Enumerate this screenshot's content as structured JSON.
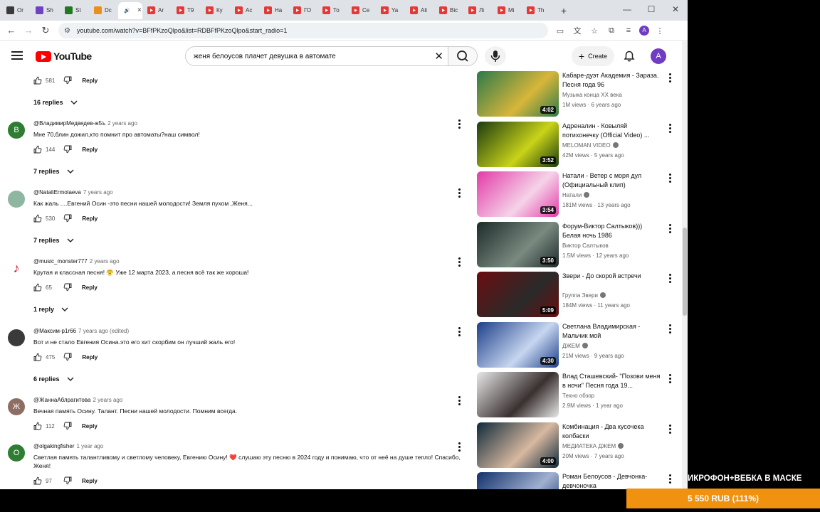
{
  "browser": {
    "tabs": [
      {
        "label": "Or",
        "icon": "tab-favicon",
        "color": "#3a3a3a"
      },
      {
        "label": "Sh",
        "icon": "tab-favicon",
        "color": "#6f42c1"
      },
      {
        "label": "St",
        "icon": "tab-favicon",
        "color": "#1f7a1f"
      },
      {
        "label": "Dc",
        "icon": "tab-favicon",
        "color": "#e8901b"
      },
      {
        "label": "",
        "icon": "speaker-icon",
        "color": "#777777",
        "active": true
      },
      {
        "label": "Ar",
        "icon": "youtube-favicon",
        "color": "#e53935"
      },
      {
        "label": "T9",
        "icon": "youtube-favicon",
        "color": "#e53935"
      },
      {
        "label": "Ку",
        "icon": "youtube-favicon",
        "color": "#e53935"
      },
      {
        "label": "Ac",
        "icon": "youtube-favicon",
        "color": "#e53935"
      },
      {
        "label": "На",
        "icon": "youtube-favicon",
        "color": "#e53935"
      },
      {
        "label": "ГО",
        "icon": "youtube-favicon",
        "color": "#e53935"
      },
      {
        "label": "То",
        "icon": "youtube-favicon",
        "color": "#e53935"
      },
      {
        "label": "Се",
        "icon": "youtube-favicon",
        "color": "#e53935"
      },
      {
        "label": "Ya",
        "icon": "youtube-favicon",
        "color": "#e53935"
      },
      {
        "label": "Ali",
        "icon": "youtube-favicon",
        "color": "#e53935"
      },
      {
        "label": "Bic",
        "icon": "youtube-favicon",
        "color": "#e53935"
      },
      {
        "label": "Лі",
        "icon": "youtube-favicon",
        "color": "#e53935"
      },
      {
        "label": "Mi",
        "icon": "youtube-favicon",
        "color": "#e53935"
      },
      {
        "label": "Th",
        "icon": "youtube-favicon",
        "color": "#e53935"
      }
    ],
    "active_tab_close": "×",
    "new_tab": "+",
    "url": "youtube.com/watch?v=BFfPKzoQlpo&list=RDBFfPKzoQlpo&start_radio=1",
    "profile_letter": "A"
  },
  "youtube": {
    "logo_text": "YouTube",
    "search_value": "женя белоусов плачет девушка в автомате",
    "create_label": "Create",
    "avatar_letter": "A"
  },
  "comments": {
    "reply_label": "Reply",
    "top_partial": {
      "likes": "581",
      "replies": "16 replies"
    },
    "items": [
      {
        "author": "@ВладимирМедведев-ж5ъ",
        "date": "2 years ago",
        "text": "Мне 70,блин дожил,кто помнит про автоматы?наш символ!",
        "likes": "144",
        "replies": "7 replies",
        "avatar_letter": "В",
        "avatar_color": "#2e7d32"
      },
      {
        "author": "@NataliErmolaeva",
        "date": "7 years ago",
        "text": "Как жаль ....Евгений Осин -это песни нашей молодости! Земля пухом ,Женя...",
        "likes": "530",
        "replies": "7 replies",
        "avatar_letter": "",
        "avatar_color": "#8fb6a0"
      },
      {
        "author": "@music_monster777",
        "date": "2 years ago",
        "text": "Крутая и классная песня! 😤 Уже 12 марта 2023, а песня всё так же хороша!",
        "likes": "65",
        "replies": "1 reply",
        "avatar_letter": "♪",
        "avatar_color": "#ffffff"
      },
      {
        "author": "@Максим-р1r66",
        "date": "7 years ago (edited)",
        "text": "Вот и не стало Евгения Осина.это его хит скорбим он лучший жаль его!",
        "likes": "475",
        "replies": "6 replies",
        "avatar_letter": "",
        "avatar_color": "#3a3a3a"
      },
      {
        "author": "@ЖаннаАблрагитова",
        "date": "2 years ago",
        "text": "Вечная память Осину. Талант. Песни нашей молодости. Помним всегда.",
        "likes": "112",
        "replies": "",
        "avatar_letter": "Ж",
        "avatar_color": "#8d6e63"
      },
      {
        "author": "@olgakingfisher",
        "date": "1 year ago",
        "text": "Светлая память талантливому и светлому человеку, Евгению Осину! ❤️ слушаю эту песню в 2024 году и понимаю, что от неё на душе тепло! Спасибо, Женя!",
        "likes": "97",
        "replies": "",
        "avatar_letter": "O",
        "avatar_color": "#2e7d32"
      }
    ]
  },
  "sidebar": {
    "videos": [
      {
        "title": "Кабаре-дуэт Академия - Зараза. Песня года 96",
        "channel": "Музыка конца XX века",
        "verified": false,
        "meta": "1M views · 6 years ago",
        "duration": "4:02",
        "thumb_colors": [
          "#2b7a4a",
          "#d8b63a"
        ]
      },
      {
        "title": "Адреналин - Ковыляй потихонечку (Official Video) ...",
        "channel": "MELOMAN VIDEO",
        "verified": true,
        "meta": "42M views · 5 years ago",
        "duration": "3:52",
        "thumb_colors": [
          "#1a3a10",
          "#c9d318"
        ]
      },
      {
        "title": "Натали - Ветер с моря дул (Официальный клип)",
        "channel": "Натали",
        "verified": true,
        "meta": "181M views · 13 years ago",
        "duration": "3:54",
        "thumb_colors": [
          "#e23ba8",
          "#f5d3e8"
        ]
      },
      {
        "title": "Форум-Виктор Салтыков))) Белая ночь 1986",
        "channel": "Виктор Салтыков",
        "verified": false,
        "meta": "1.5M views · 12 years ago",
        "duration": "3:50",
        "thumb_colors": [
          "#1d2a2a",
          "#7a8a80"
        ]
      },
      {
        "title": "Звери - До скорой встречи",
        "channel": "Группа Звери",
        "verified": true,
        "meta": "184M views · 11 years ago",
        "duration": "5:09",
        "thumb_colors": [
          "#6b0d10",
          "#2a2a2a"
        ]
      },
      {
        "title": "Светлана Владимирская - Мальчик мой",
        "channel": "ДЖЕМ",
        "verified": true,
        "meta": "21M views · 9 years ago",
        "duration": "4:30",
        "thumb_colors": [
          "#1c3f8a",
          "#c7d6f0"
        ]
      },
      {
        "title": "Влад Сташевский- \"Позови меня в ночи\" Песня года 19...",
        "channel": "Техно обзор",
        "verified": false,
        "meta": "2.9M views · 1 year ago",
        "duration": "",
        "thumb_colors": [
          "#e8e8e8",
          "#3a3030"
        ]
      },
      {
        "title": "Комбинация - Два кусочека колбаски",
        "channel": "МЕДИАТЕКА ДЖЕМ",
        "verified": true,
        "meta": "20M views · 7 years ago",
        "duration": "4:00",
        "thumb_colors": [
          "#0e2a3a",
          "#d8b8a0"
        ]
      },
      {
        "title": "Роман Белоусов - Девчонка-девчоночка",
        "channel": "",
        "verified": false,
        "meta": "",
        "duration": "",
        "thumb_colors": [
          "#12306a",
          "#a0b0d0"
        ]
      }
    ]
  },
  "overlay": {
    "headline": "ИКРОФОН+ВЕБКА В МАСКЕ",
    "donation": "5 550 RUB (111%)",
    "accent": "#f0910f"
  }
}
